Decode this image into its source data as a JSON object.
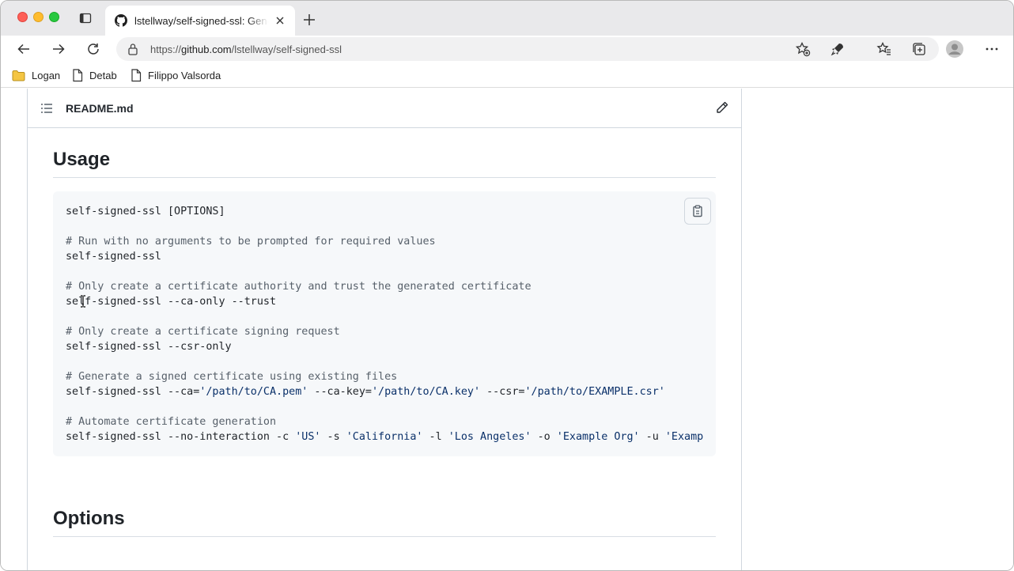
{
  "browser": {
    "tab_title": "lstellway/self-signed-ssl: Generate self-signed SSL certificates",
    "url_prefix": "https://",
    "url_host": "github.com",
    "url_path": "/lstellway/self-signed-ssl"
  },
  "favorites": [
    {
      "label": "Logan",
      "icon": "folder-icon"
    },
    {
      "label": "Detab",
      "icon": "page-icon"
    },
    {
      "label": "Filippo Valsorda",
      "icon": "page-icon"
    }
  ],
  "readme": {
    "filename": "README.md",
    "usage_heading": "Usage",
    "options_heading": "Options"
  },
  "code": {
    "line1": "self-signed-ssl [OPTIONS]",
    "c1": "# Run with no arguments to be prompted for required values",
    "line2": "self-signed-ssl",
    "c2": "# Only create a certificate authority and trust the generated certificate",
    "line3": "self-signed-ssl --ca-only --trust",
    "c3": "# Only create a certificate signing request",
    "line4": "self-signed-ssl --csr-only",
    "c4": "# Generate a signed certificate using existing files",
    "line5a": "self-signed-ssl --ca=",
    "line5b": "'/path/to/CA.pem'",
    "line5c": " --ca-key=",
    "line5d": "'/path/to/CA.key'",
    "line5e": " --csr=",
    "line5f": "'/path/to/EXAMPLE.csr'",
    "c5": "# Automate certificate generation",
    "line6a": "self-signed-ssl --no-interaction -c ",
    "line6b": "'US'",
    "line6c": " -s ",
    "line6d": "'California'",
    "line6e": " -l ",
    "line6f": "'Los Angeles'",
    "line6g": " -o ",
    "line6h": "'Example Org'",
    "line6i": " -u ",
    "line6j": "'Examp"
  }
}
